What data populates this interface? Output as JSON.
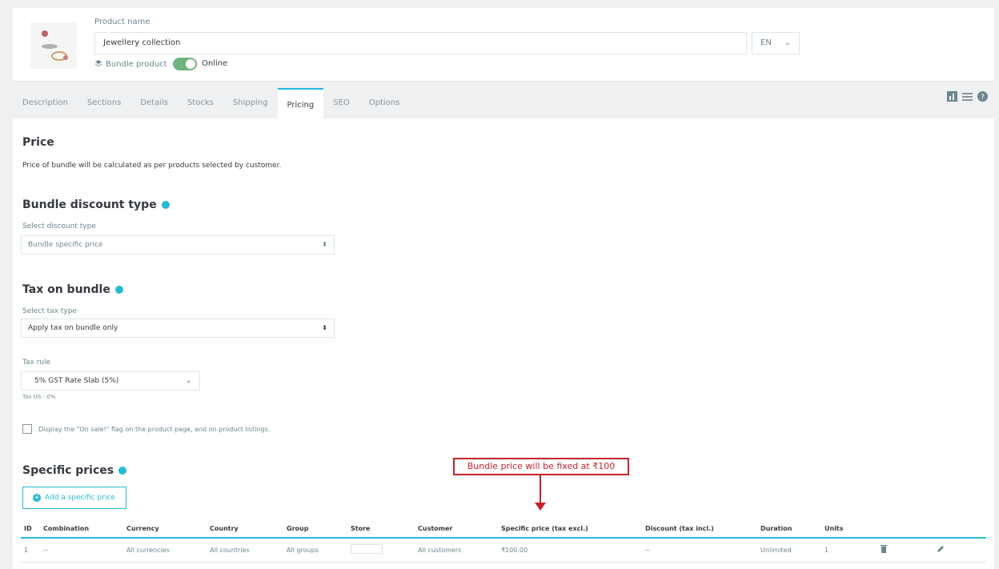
{
  "header": {
    "product_name_label": "Product name",
    "product_name_value": "Jewellery collection",
    "language": "EN",
    "product_type": "Bundle product",
    "status": "Online"
  },
  "tabs": [
    "Description",
    "Sections",
    "Details",
    "Stocks",
    "Shipping",
    "Pricing",
    "SEO",
    "Options"
  ],
  "price": {
    "title": "Price",
    "note": "Price of bundle will be calculated as per products selected by customer."
  },
  "discount": {
    "title": "Bundle discount type",
    "label": "Select discount type",
    "value": "Bundle specific price"
  },
  "tax": {
    "title": "Tax on bundle",
    "label": "Select tax type",
    "value": "Apply tax on bundle only",
    "rule_label": "Tax rule",
    "rule_value": "5% GST Rate Slab (5%)",
    "tax_note": "Tax US : 0%"
  },
  "on_sale": "Display the \"On sale!\" flag on the product page, and on product listings.",
  "specific": {
    "title": "Specific prices",
    "add_button": "Add a specific price",
    "columns": [
      "ID",
      "Combination",
      "Currency",
      "Country",
      "Group",
      "Store",
      "Customer",
      "Specific price (tax excl.)",
      "Discount (tax incl.)",
      "Duration",
      "Units",
      "",
      ""
    ],
    "rows": [
      [
        "1",
        "--",
        "All currencies",
        "All countries",
        "All groups",
        "",
        "All customers",
        "₹100.00",
        "--",
        "Unlimited",
        "1",
        "",
        ""
      ]
    ]
  },
  "annotation": "Bundle price will be fixed at ₹100"
}
